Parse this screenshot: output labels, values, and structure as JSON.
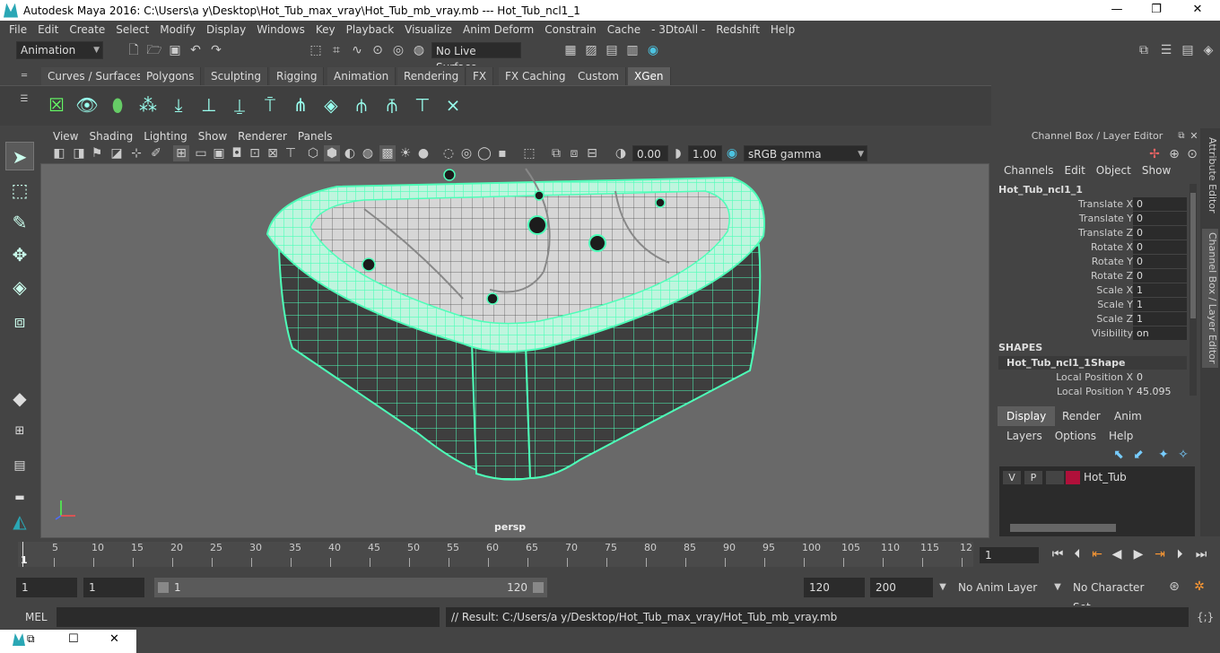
{
  "window": {
    "title": "Autodesk Maya 2016: C:\\Users\\a y\\Desktop\\Hot_Tub_max_vray\\Hot_Tub_mb_vray.mb    ---    Hot_Tub_ncl1_1",
    "minimize": "—",
    "maximize": "❐",
    "close": "✕"
  },
  "menu": [
    "File",
    "Edit",
    "Create",
    "Select",
    "Modify",
    "Display",
    "Windows",
    "Key",
    "Playback",
    "Visualize",
    "Anim Deform",
    "Constrain",
    "Cache",
    "- 3DtoAll -",
    "Redshift",
    "Help"
  ],
  "statusline": {
    "mode": "Animation",
    "live_surface": "No Live Surface"
  },
  "shelf_tabs": [
    "Curves / Surfaces",
    "Polygons",
    "Sculpting",
    "Rigging",
    "Animation",
    "Rendering",
    "FX",
    "FX Caching",
    "Custom",
    "XGen"
  ],
  "viewport": {
    "menu": [
      "View",
      "Shading",
      "Lighting",
      "Show",
      "Renderer",
      "Panels"
    ],
    "exposure": "0.00",
    "gamma": "1.00",
    "colorspace": "sRGB gamma",
    "camera_label": "persp"
  },
  "channel_box": {
    "title": "Channel Box / Layer Editor",
    "menu": [
      "Channels",
      "Edit",
      "Object",
      "Show"
    ],
    "object": "Hot_Tub_ncl1_1",
    "attributes": [
      {
        "label": "Translate X",
        "value": "0"
      },
      {
        "label": "Translate Y",
        "value": "0"
      },
      {
        "label": "Translate Z",
        "value": "0"
      },
      {
        "label": "Rotate X",
        "value": "0"
      },
      {
        "label": "Rotate Y",
        "value": "0"
      },
      {
        "label": "Rotate Z",
        "value": "0"
      },
      {
        "label": "Scale X",
        "value": "1"
      },
      {
        "label": "Scale Y",
        "value": "1"
      },
      {
        "label": "Scale Z",
        "value": "1"
      },
      {
        "label": "Visibility",
        "value": "on"
      }
    ],
    "shapes_header": "SHAPES",
    "shape_name": "Hot_Tub_ncl1_1Shape",
    "shape_attributes": [
      {
        "label": "Local Position X",
        "value": "0"
      },
      {
        "label": "Local Position Y",
        "value": "45.095"
      }
    ]
  },
  "side_tabs": [
    "Attribute Editor",
    "Channel Box / Layer Editor"
  ],
  "layer_editor": {
    "tabs": [
      "Display",
      "Render",
      "Anim"
    ],
    "menu": [
      "Layers",
      "Options",
      "Help"
    ],
    "layer": {
      "v": "V",
      "p": "P",
      "name": "Hot_Tub",
      "color": "#b0103a"
    }
  },
  "timeline": {
    "ticks": [
      "5",
      "10",
      "15",
      "20",
      "25",
      "30",
      "35",
      "40",
      "45",
      "50",
      "55",
      "60",
      "65",
      "70",
      "75",
      "80",
      "85",
      "90",
      "95",
      "100",
      "105",
      "110",
      "115",
      "12"
    ],
    "start_marker": "1",
    "current_frame": "1"
  },
  "range": {
    "start": "1",
    "inner_start": "1",
    "slider_start": "1",
    "slider_end": "120",
    "end": "120",
    "outer_end": "200",
    "anim_layer": "No Anim Layer",
    "character_set": "No Character Set"
  },
  "command": {
    "lang": "MEL",
    "result": "// Result: C:/Users/a y/Desktop/Hot_Tub_max_vray/Hot_Tub_mb_vray.mb"
  },
  "colors": {
    "wireframe": "#4dffb8",
    "accent": "#2aa7b5"
  }
}
